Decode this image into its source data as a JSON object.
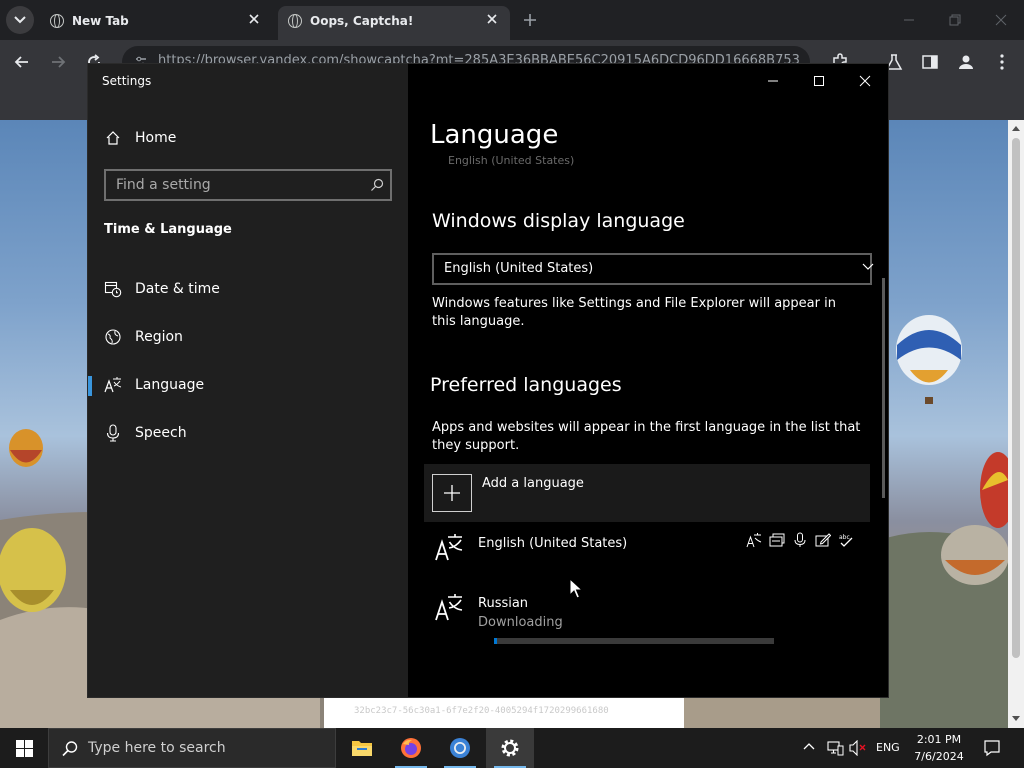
{
  "browser": {
    "tabs": [
      {
        "title": "New Tab",
        "active": false
      },
      {
        "title": "Oops, Captcha!",
        "active": true
      }
    ],
    "url": "https://browser.yandex.com/showcaptcha?mt=285A3E36BBABE56C20915A6DCD96DD16668B753",
    "captcha_hash": "32bc23c7-56c30a1-6f7e2f20-4005294f1720299661680"
  },
  "settings": {
    "window_title": "Settings",
    "home_label": "Home",
    "search_placeholder": "Find a setting",
    "section_title": "Time & Language",
    "nav": [
      {
        "label": "Date & time",
        "icon": "calendar-clock-icon",
        "active": false
      },
      {
        "label": "Region",
        "icon": "globe-icon",
        "active": false
      },
      {
        "label": "Language",
        "icon": "language-icon",
        "active": true
      },
      {
        "label": "Speech",
        "icon": "microphone-icon",
        "active": false
      }
    ],
    "page_title": "Language",
    "faded_text": "English (United States)",
    "display_language": {
      "heading": "Windows display language",
      "selected": "English (United States)",
      "description": "Windows features like Settings and File Explorer will appear in this language."
    },
    "preferred": {
      "heading": "Preferred languages",
      "description": "Apps and websites will appear in the first language in the list that they support.",
      "add_label": "Add a language",
      "languages": [
        {
          "name": "English (United States)",
          "status": "",
          "features": [
            "display-language-icon",
            "text-to-speech-icon",
            "speech-recognition-icon",
            "handwriting-icon",
            "spellcheck-icon"
          ]
        },
        {
          "name": "Russian",
          "status": "Downloading",
          "progress": 0.01
        }
      ]
    }
  },
  "taskbar": {
    "search_placeholder": "Type here to search",
    "apps": [
      "file-explorer-icon",
      "firefox-icon",
      "chrome-icon",
      "settings-icon"
    ],
    "language": "ENG",
    "time": "2:01 PM",
    "date": "7/6/2024"
  },
  "colors": {
    "accent": "#0078d4",
    "active_indicator": "#3a96dd",
    "settings_sidebar": "#1f1f1f",
    "settings_main": "#000000"
  }
}
